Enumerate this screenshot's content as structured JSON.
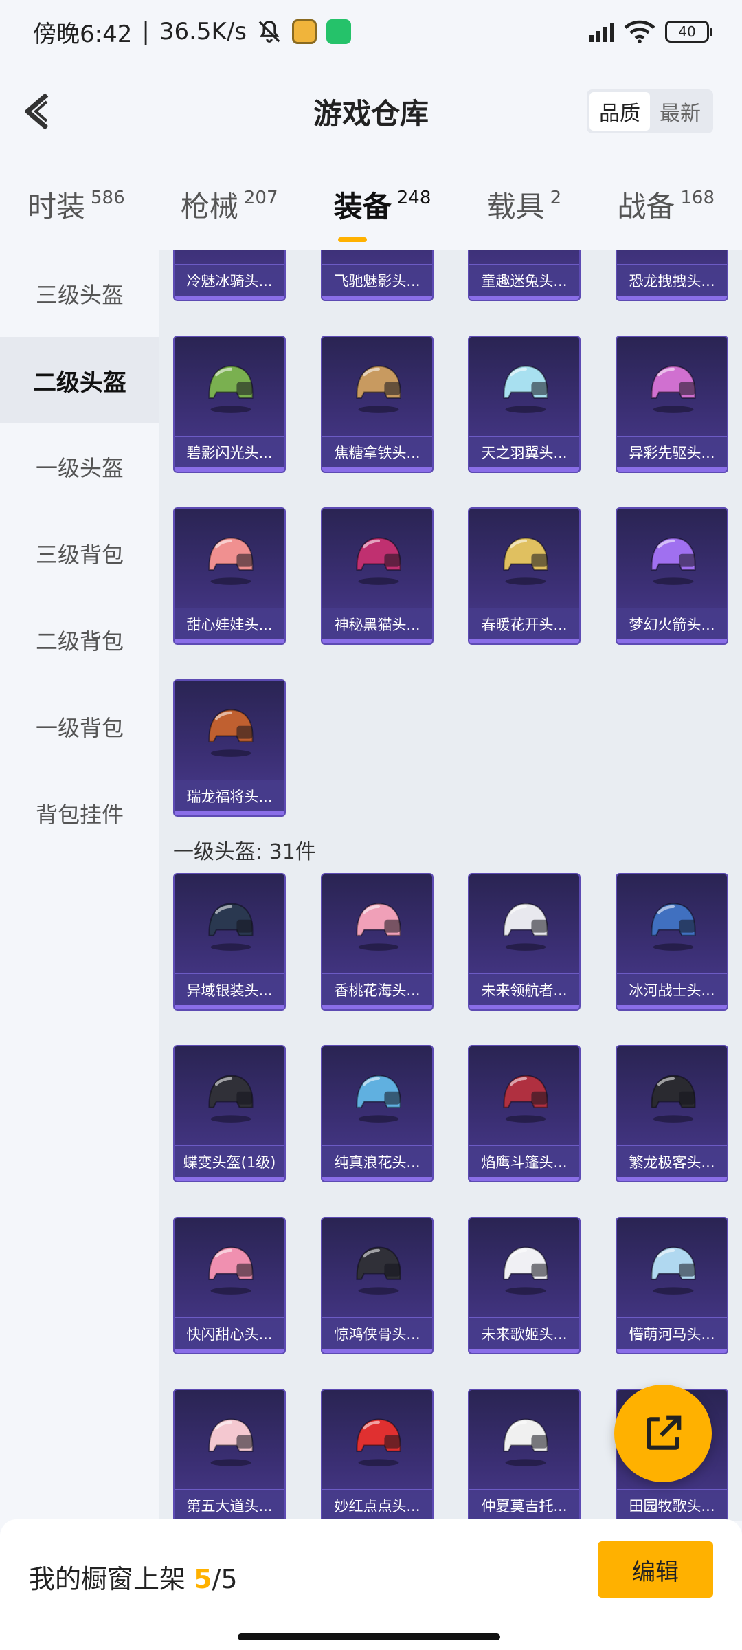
{
  "status_bar": {
    "time": "傍晚6:42",
    "speed": "36.5K/s",
    "battery": "40"
  },
  "header": {
    "title": "游戏仓库",
    "sort_options": [
      "品质",
      "最新"
    ],
    "sort_selected": "品质"
  },
  "categories": [
    {
      "label": "时装",
      "count": "586"
    },
    {
      "label": "枪械",
      "count": "207"
    },
    {
      "label": "装备",
      "count": "248",
      "active": true
    },
    {
      "label": "载具",
      "count": "2"
    },
    {
      "label": "战备",
      "count": "168"
    }
  ],
  "sidebar": {
    "items": [
      "三级头盔",
      "二级头盔",
      "一级头盔",
      "三级背包",
      "二级背包",
      "一级背包",
      "背包挂件"
    ],
    "active": "二级头盔"
  },
  "level2_items": [
    {
      "name": "冷魅冰骑头...",
      "color": "#6aa0e0"
    },
    {
      "name": "飞驰魅影头...",
      "color": "#9a60d0"
    },
    {
      "name": "童趣迷兔头...",
      "color": "#f0c0d0"
    },
    {
      "name": "恐龙拽拽头...",
      "color": "#60c080"
    },
    {
      "name": "碧影闪光头...",
      "color": "#7ab050"
    },
    {
      "name": "焦糖拿铁头...",
      "color": "#c89a60"
    },
    {
      "name": "天之羽翼头...",
      "color": "#a8e0f0"
    },
    {
      "name": "异彩先驱头...",
      "color": "#d070d0"
    },
    {
      "name": "甜心娃娃头...",
      "color": "#f09090"
    },
    {
      "name": "神秘黑猫头...",
      "color": "#c03070"
    },
    {
      "name": "春暖花开头...",
      "color": "#e0c060"
    },
    {
      "name": "梦幻火箭头...",
      "color": "#a070f0"
    },
    {
      "name": "瑞龙福将头...",
      "color": "#c06030"
    }
  ],
  "level1_section": {
    "title": "一级头盔: 31件"
  },
  "level1_items": [
    {
      "name": "异域银装头...",
      "color": "#2a3850"
    },
    {
      "name": "香桃花海头...",
      "color": "#f0a0b8"
    },
    {
      "name": "未来领航者...",
      "color": "#e8e8ee"
    },
    {
      "name": "冰河战士头...",
      "color": "#4070c0"
    },
    {
      "name": "蝶变头盔(1级)",
      "color": "#303038"
    },
    {
      "name": "纯真浪花头...",
      "color": "#60b0e0"
    },
    {
      "name": "焰鹰斗篷头...",
      "color": "#b03040"
    },
    {
      "name": "繁龙极客头...",
      "color": "#2a2a30"
    },
    {
      "name": "快闪甜心头...",
      "color": "#f090b0"
    },
    {
      "name": "惊鸿侠骨头...",
      "color": "#303038"
    },
    {
      "name": "未来歌姬头...",
      "color": "#f0f0f4"
    },
    {
      "name": "懵萌河马头...",
      "color": "#b0d8f0"
    },
    {
      "name": "第五大道头...",
      "color": "#f4c8d0"
    },
    {
      "name": "妙红点点头...",
      "color": "#e03030"
    },
    {
      "name": "仲夏莫吉托...",
      "color": "#f0f0f0"
    },
    {
      "name": "田园牧歌头...",
      "color": "#f0e0c0"
    }
  ],
  "bottom_bar": {
    "label_prefix": "我的橱窗上架",
    "count_current": "5",
    "count_sep": "/",
    "count_total": "5",
    "edit_label": "编辑"
  },
  "colors": {
    "accent": "#ffb100",
    "card_bg": "#3b2f74"
  }
}
